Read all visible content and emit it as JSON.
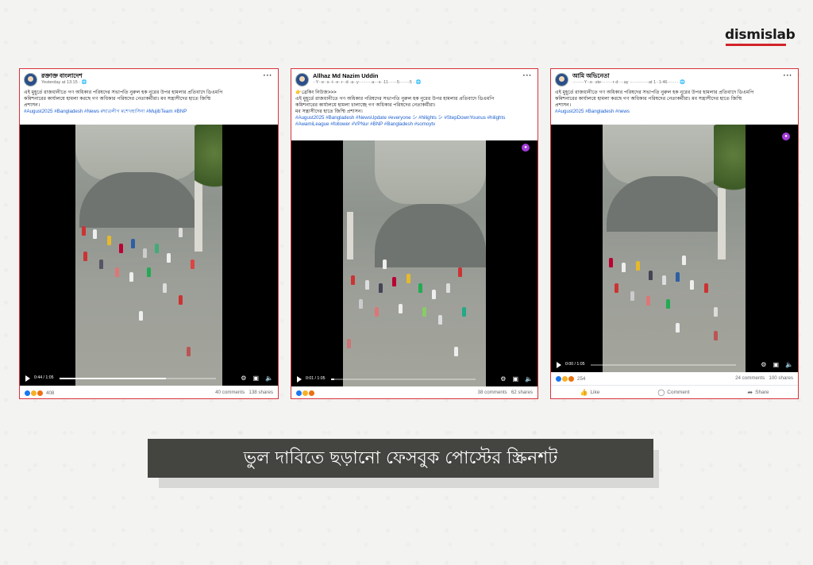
{
  "brand": {
    "logo_text": "dismislab",
    "accent": "#d2232a"
  },
  "posts": [
    {
      "author": "রক্তাক্ত বাংলাদেশ",
      "meta": "Yesterday at 13:15 · 🌐",
      "text": [
        "এই মুহূর্তে রাজধানীতে গণ অধিকার পরিষদের সভাপতি নুরুল হক নুরের উপর হামলার প্রতিবাদে ডিএমপি",
        "কমিশনারের কার্যালয়ে হামলা করছে গণ অধিকার পরিষদের নেতাকর্মীরা। মব সন্ত্রাসীদের হাতে জিম্মি",
        "প্রশাসন।"
      ],
      "tags": "#August2025 #Bangladesh #News #ছাত্রলীগ #শেখহাসিনা #MujibTeam #BNP",
      "video_time": "0:44 / 1:05",
      "progress": 0.68,
      "reaction_count": "408",
      "comments": "40 comments",
      "shares": "138 shares"
    },
    {
      "author": "Allhaz Md Nazim Uddin",
      "meta": "··Y··e··s··t··e··r··d··a··y·········a···s··11······5·······5 · 🌐",
      "text": [
        "👉ব্রেকিং নিউজ>>>",
        "এই মুহূর্তে রাজধানীতে গণ অধিকার পরিষদের সভাপতি নুরুল হক নুরের উপর হামলার প্রতিবাদে ডিএমপি",
        "কমিশনারের কার্যালয়ে হামলা চালাচ্ছে গণ অধিকার পরিষদের নেতাকর্মীরা।",
        "মব সন্ত্রাসীদের হাতে জিম্মি প্রশাসন।"
      ],
      "tags": "#August2025 #Bangladesh #NewsUpdate #everyone シ #hilights シ #StepDownYounus #hilights #AwamiLeague #follower #VPNur #BNP #Bangladesh #somoytv",
      "video_time": "0:01 / 1:05",
      "progress": 0.02,
      "reaction_count": "",
      "comments": "38 comments",
      "shares": "62 shares"
    },
    {
      "author": "আমি অভিনেতা",
      "meta": "········Y··e··ste········r·d····ay ·············at 1··1:46······ · 🌐",
      "text": [
        "এই মুহূর্তে রাজধানীতে গণ অধিকার পরিষদের সভাপতি নুরুল হক নুরের উপর হামলার প্রতিবাদে ডিএমপি",
        "কমিশনারের কার্যালয়ে হামলা করছে গণ অধিকার পরিষদের নেতাকর্মীরা। মব সন্ত্রাসীদের হাতে জিম্মি",
        "প্রশাসন।"
      ],
      "tags": "#August2025 #Bangladesh #news",
      "video_time": "0:00 / 1:05",
      "progress": 0.0,
      "reaction_count": "254",
      "comments": "24 comments",
      "shares": "100 shares",
      "like_label": "Like",
      "comment_label": "Comment",
      "share_label": "Share"
    }
  ],
  "caption": "ভুল দাবিতে ছড়ানো ফেসবুক পোস্টের স্ক্রিনশট"
}
